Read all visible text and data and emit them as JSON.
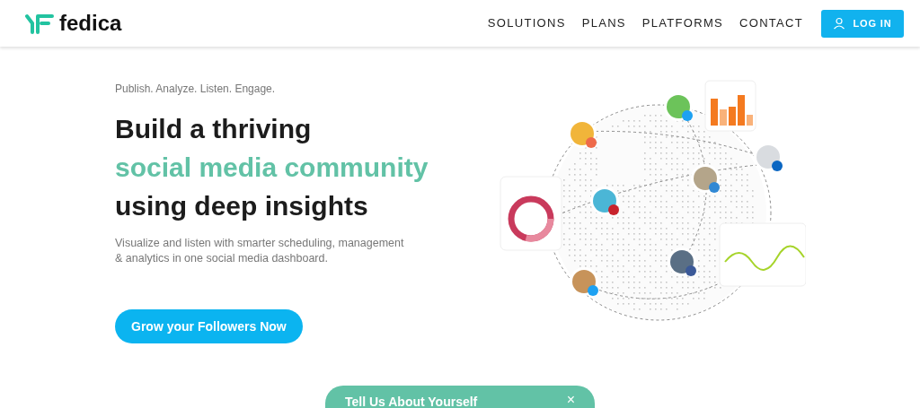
{
  "header": {
    "logo": "fedica",
    "nav": [
      {
        "label": "SOLUTIONS"
      },
      {
        "label": "PLANS"
      },
      {
        "label": "PLATFORMS"
      },
      {
        "label": "CONTACT"
      }
    ],
    "login_button": "LOG IN"
  },
  "hero": {
    "tagline": "Publish. Analyze. Listen. Engage.",
    "heading_lines": [
      {
        "text": "Build a thriving",
        "kind": "plain"
      },
      {
        "text": "social media community",
        "kind": "accent"
      },
      {
        "text": "using deep insights",
        "kind": "plain"
      }
    ],
    "description": "Visualize and listen with smarter scheduling, management & analytics in one social media dashboard.",
    "cta": "Grow your Followers Now"
  },
  "survey_panel": {
    "title": "Tell Us About Yourself",
    "close": "×"
  }
}
